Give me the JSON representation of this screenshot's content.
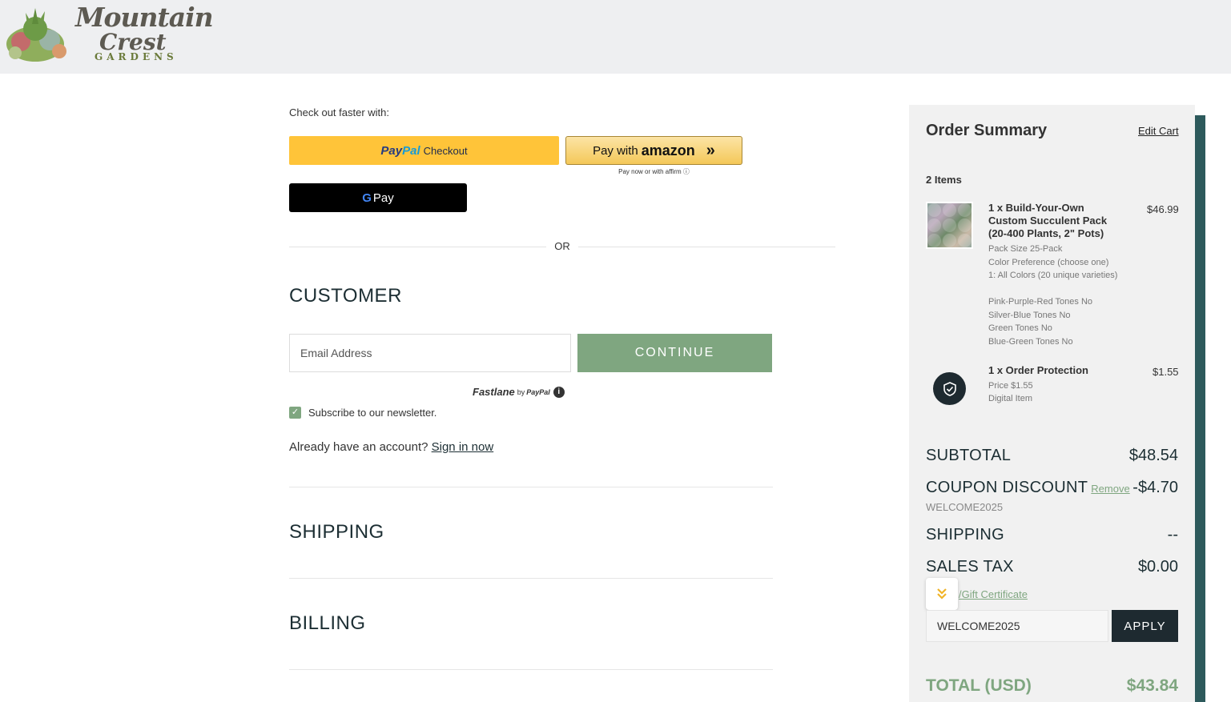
{
  "brand": {
    "line1": "Mountain",
    "line2": "Crest",
    "line3": "GARDENS"
  },
  "checkout": {
    "faster_label": "Check out faster with:",
    "paypal": {
      "brand1": "Pay",
      "brand2": "Pal",
      "label": "Checkout"
    },
    "amazon": {
      "prefix": "Pay with",
      "brand": "amazon",
      "arrows": "»"
    },
    "affirm_note": "Pay now or with affirm ⓘ",
    "gpay": {
      "g": "G",
      "label": "Pay"
    },
    "or_label": "OR"
  },
  "customer": {
    "heading": "CUSTOMER",
    "email_placeholder": "Email Address",
    "continue_label": "CONTINUE",
    "fastlane": {
      "name": "Fastlane",
      "by": "by",
      "paypal": "PayPal",
      "info": "i"
    },
    "subscribe_label": "Subscribe to our newsletter.",
    "account_text": "Already have an account?",
    "sign_in_label": "Sign in now"
  },
  "sections": {
    "shipping": "SHIPPING",
    "billing": "BILLING"
  },
  "summary": {
    "title": "Order Summary",
    "edit_cart": "Edit Cart",
    "items_count": "2 Items",
    "product": {
      "name": "1 x Build-Your-Own Custom Succulent Pack (20-400 Plants, 2\" Pots)",
      "price": "$46.99",
      "options": [
        "Pack Size 25-Pack",
        "Color Preference (choose one)",
        "1: All Colors (20 unique varieties)",
        "Pink-Purple-Red Tones No",
        "Silver-Blue Tones No",
        "Green Tones No",
        "Blue-Green Tones No"
      ]
    },
    "protection": {
      "name": "1 x Order Protection",
      "price": "$1.55",
      "options": [
        "Price $1.55",
        "Digital Item"
      ]
    },
    "subtotal_label": "SUBTOTAL",
    "subtotal_value": "$48.54",
    "coupon_label": "COUPON DISCOUNT",
    "coupon_remove": "Remove",
    "coupon_value": "-$4.70",
    "coupon_code": "WELCOME2025",
    "shipping_label": "SHIPPING",
    "shipping_value": "--",
    "tax_label": "SALES TAX",
    "tax_value": "$0.00",
    "gift_link": "/Gift Certificate",
    "coupon_input_value": "WELCOME2025",
    "apply_label": "APPLY",
    "total_label": "TOTAL (USD)",
    "total_value": "$43.84"
  },
  "colors": {
    "accent_green": "#7fa680",
    "dark": "#1e2a30",
    "paypal_yellow": "#ffc439",
    "teal_edge": "#2d5a5c"
  },
  "icons": {
    "checkbox": "check-icon",
    "protection": "shield-check-icon",
    "floating": "chevron-double-down-icon",
    "info": "info-icon"
  }
}
